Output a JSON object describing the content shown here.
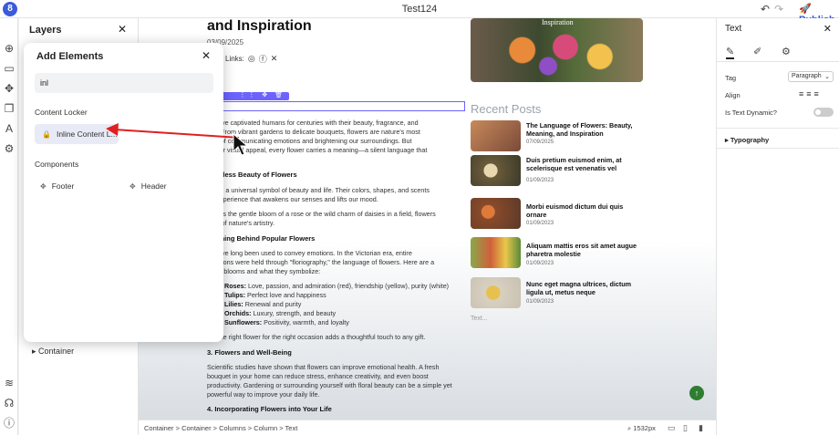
{
  "window": {
    "title": "Test124",
    "publish_label": "Publish"
  },
  "layers": {
    "title": "Layers",
    "container_label": "Container"
  },
  "popup": {
    "title": "Add Elements",
    "search_value": "inl",
    "sections": {
      "locker": "Content Locker",
      "components": "Components"
    },
    "locker_item": "Inline Content L...",
    "components": [
      "Footer",
      "Header"
    ]
  },
  "article": {
    "title": "and Inspiration",
    "date": "03/09/2025",
    "links_label": "Links:",
    "paragraphs": [
      "rs have captivated humans for centuries with their beauty, fragrance, and",
      "ism. From vibrant gardens to delicate bouquets, flowers are nature's most",
      "way of communicating emotions and brightening our surroundings. But",
      "d their visual appeal, every flower carries a meaning—a silent language that",
      "story."
    ],
    "h_beauty": "Timeless Beauty of Flowers",
    "beauty_lines": [
      "rs are a universal symbol of beauty and life. Their colors, shapes, and scents",
      "an experience that awakens our senses and lifts our mood.",
      "her it's the gentle bloom of a rose or the wild charm of daisies in a field, flowers",
      "d us of nature's artistry."
    ],
    "h_meaning": "Meaning Behind Popular Flowers",
    "meaning_lines": [
      "rs have long been used to convey emotions. In the Victorian era, entire",
      "ersations were held through \"floriography,\" the language of flowers. Here are a",
      "assic blooms and what they symbolize:"
    ],
    "flowers": [
      {
        "name": "Roses:",
        "desc": " Love, passion, and admiration (red), friendship (yellow), purity (white)"
      },
      {
        "name": "Tulips:",
        "desc": " Perfect love and happiness"
      },
      {
        "name": "Lilies:",
        "desc": " Renewal and purity"
      },
      {
        "name": "Orchids:",
        "desc": " Luxury, strength, and beauty"
      },
      {
        "name": "Sunflowers:",
        "desc": " Positivity, warmth, and loyalty"
      }
    ],
    "closing_line": "ing the right flower for the right occasion adds a thoughtful touch to any gift.",
    "h_wellbeing": "3. Flowers and Well-Being",
    "wellbeing_lines": [
      "Scientific studies have shown that flowers can improve emotional health. A fresh",
      "bouquet in your home can reduce stress, enhance creativity, and even boost",
      "productivity. Gardening or surrounding yourself with floral beauty can be a simple yet",
      "powerful way to improve your daily life."
    ],
    "h_incorporating": "4. Incorporating Flowers into Your Life",
    "hero_caption": "Inspiration"
  },
  "recent": {
    "title": "Recent Posts",
    "posts": [
      {
        "title": "The Language of Flowers: Beauty, Meaning, and Inspiration",
        "date": "07/09/2025",
        "color": "#a86a4a"
      },
      {
        "title": "Duis pretium euismod enim, at scelerisque est venenatis vel",
        "date": "01/09/2023",
        "color": "#7a6a4a"
      },
      {
        "title": "Morbi euismod dictum dui quis ornare",
        "date": "01/09/2023",
        "color": "#b5593a"
      },
      {
        "title": "Aliquam mattis eros sit amet augue pharetra molestie",
        "date": "01/09/2023",
        "color": "#5a7a3a"
      },
      {
        "title": "Nunc eget magna ultrices, dictum ligula ut, metus neque",
        "date": "01/09/2023",
        "color": "#c9a64a"
      }
    ],
    "text_placeholder": "Text..."
  },
  "breadcrumb": {
    "path": "Container  >  Container  >  Columns  >  Column  >  Text",
    "zoom": "1532px"
  },
  "right_panel": {
    "title": "Text",
    "tag_label": "Tag",
    "tag_value": "Paragraph",
    "align_label": "Align",
    "dynamic_label": "Is Text Dynamic?",
    "typography_label": "Typography"
  },
  "colors": {
    "accent": "#6c63ff",
    "brand": "#3b5bdb",
    "annotation": "#e02020"
  }
}
